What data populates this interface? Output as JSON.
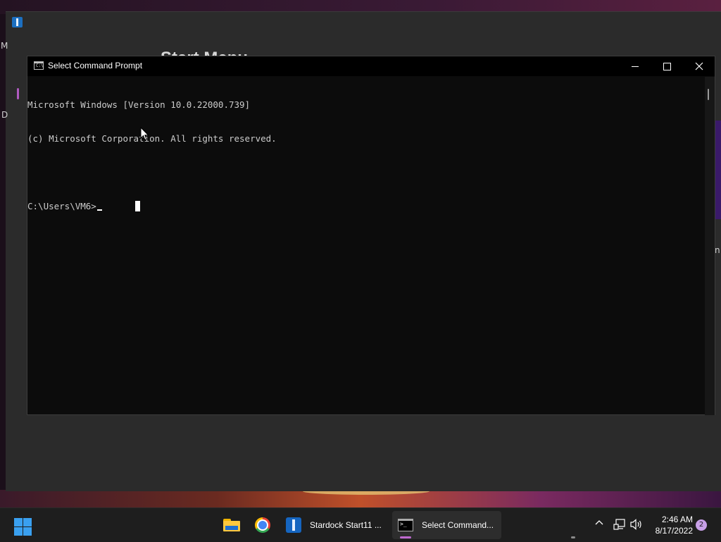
{
  "background_window": {
    "title": "Start Menu",
    "left_letters": [
      "M",
      "D"
    ],
    "right_letter": "n"
  },
  "cmd_window": {
    "title": "Select Command Prompt",
    "console_lines": [
      "Microsoft Windows [Version 10.0.22000.739]",
      "(c) Microsoft Corporation. All rights reserved.",
      "",
      "C:\\Users\\VM6>"
    ],
    "controls": {
      "minimize": "minimize-icon",
      "maximize": "maximize-icon",
      "close": "close-icon"
    }
  },
  "taskbar": {
    "pinned": [
      {
        "name": "File Explorer",
        "icon": "folder-icon"
      },
      {
        "name": "Google Chrome",
        "icon": "chrome-icon"
      }
    ],
    "apps": [
      {
        "label": "Stardock Start11 ...",
        "icon": "start11-icon"
      },
      {
        "label": "Select Command...",
        "icon": "cmd-icon"
      }
    ],
    "clock": {
      "time": "2:46 AM",
      "date": "8/17/2022"
    },
    "notification_count": "2"
  },
  "colors": {
    "accent": "#c06ad0",
    "start": "#3aa0f0",
    "console_bg": "#0c0c0c",
    "console_text": "#cccccc"
  }
}
